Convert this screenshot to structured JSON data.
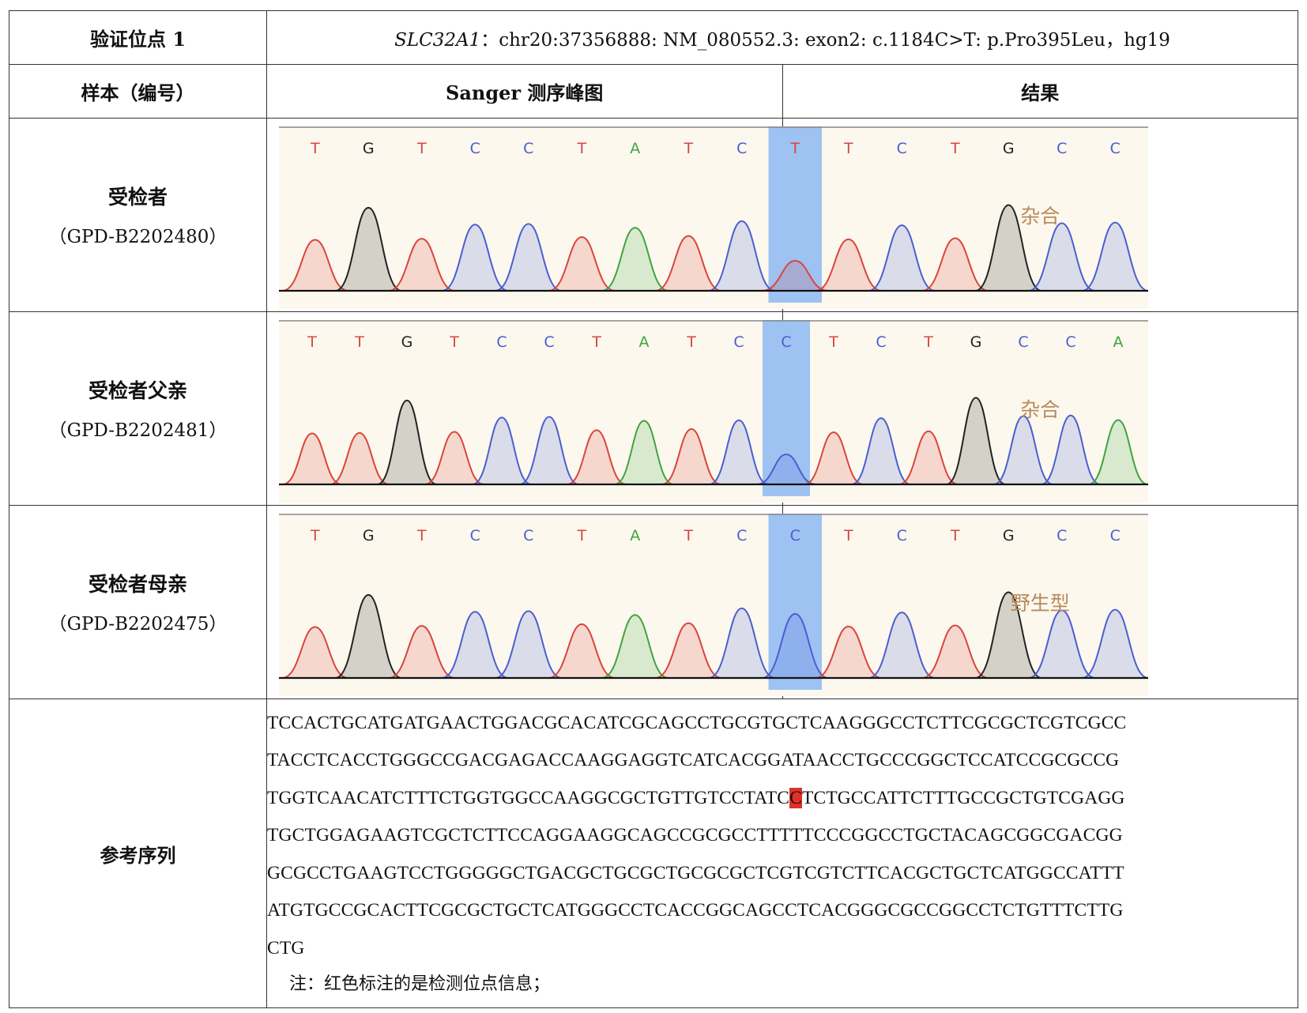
{
  "header": {
    "locus_label": "验证位点 1",
    "locus_gene": "SLC32A1",
    "locus_detail": "：chr20:37356888: NM_080552.3: exon2: c.1184C>T: p.Pro395Leu，hg19"
  },
  "columns": {
    "sample": "样本（编号）",
    "chromatogram": "Sanger 测序峰图",
    "result": "结果"
  },
  "samples": [
    {
      "name": "受检者",
      "id": "（GPD-B2202480）",
      "result": "杂合",
      "bases": [
        "T",
        "G",
        "T",
        "C",
        "C",
        "T",
        "A",
        "T",
        "C",
        "T",
        "T",
        "C",
        "T",
        "G",
        "C",
        "C"
      ],
      "highlight_index": 9
    },
    {
      "name": "受检者父亲",
      "id": "（GPD-B2202481）",
      "result": "杂合",
      "bases": [
        "T",
        "T",
        "G",
        "T",
        "C",
        "C",
        "T",
        "A",
        "T",
        "C",
        "C",
        "T",
        "C",
        "T",
        "G",
        "C",
        "C",
        "A"
      ],
      "highlight_index": 10
    },
    {
      "name": "受检者母亲",
      "id": "（GPD-B2202475）",
      "result": "野生型",
      "bases": [
        "T",
        "G",
        "T",
        "C",
        "C",
        "T",
        "A",
        "T",
        "C",
        "C",
        "T",
        "C",
        "T",
        "G",
        "C",
        "C"
      ],
      "highlight_index": 9
    }
  ],
  "reference": {
    "label": "参考序列",
    "lines": [
      "TCCACTGCATGATGAACTGGACGCACATCGCAGCCTGCGTGCTCAAGGGCCTCTTCGCGCTCGTCGCC",
      "TACCTCACCTGGGCCGACGAGACCAAGGAGGTCATCACGGATAACCTGCCCGGCTCCATCCGCGCCG",
      "TGGTCAACATCTTTCTGGTGGCCAAGGCGCTGTTGTCCTATC",
      "C",
      "TCTGCCATTCTTTGCCGCTGTCGAGG",
      "TGCTGGAGAAGTCGCTCTTCCAGGAAGGCAGCCGCGCCTTTTTCCCGGCCTGCTACAGCGGCGACGG",
      "GCGCCTGAAGTCCTGGGGGCTGACGCTGCGCTGCGCGCTCGTCGTCTTCACGCTGCTCATGGCCATTT",
      "ATGTGCCGCACTTCGCGCTGCTCATGGGCCTCACCGGCAGCCTCACGGGCGCCGGCCTCTGTTTCTTG",
      "CTG"
    ],
    "note": "注：红色标注的是检测位点信息；"
  },
  "colors": {
    "A": "#3fa43f",
    "C": "#4a5fd0",
    "G": "#222222",
    "T": "#d9453c",
    "highlight": "#9ec2f2",
    "result_text": "#b98a5a",
    "mark": "#e03028"
  }
}
